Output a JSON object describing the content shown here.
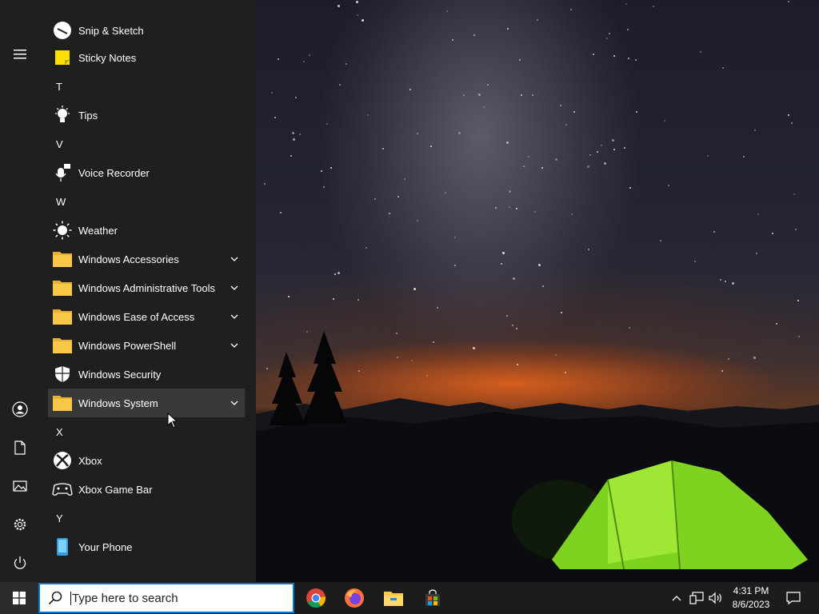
{
  "start_menu": {
    "partial_item": "Snip & Sketch",
    "items": [
      {
        "kind": "app",
        "label": "Sticky Notes",
        "icon": "sticky-notes-icon"
      },
      {
        "kind": "letter",
        "label": "T"
      },
      {
        "kind": "app",
        "label": "Tips",
        "icon": "lightbulb-icon"
      },
      {
        "kind": "letter",
        "label": "V"
      },
      {
        "kind": "app",
        "label": "Voice Recorder",
        "icon": "microphone-icon"
      },
      {
        "kind": "letter",
        "label": "W"
      },
      {
        "kind": "app",
        "label": "Weather",
        "icon": "sun-icon"
      },
      {
        "kind": "folder",
        "label": "Windows Accessories",
        "icon": "folder-icon"
      },
      {
        "kind": "folder",
        "label": "Windows Administrative Tools",
        "icon": "folder-icon"
      },
      {
        "kind": "folder",
        "label": "Windows Ease of Access",
        "icon": "folder-icon"
      },
      {
        "kind": "folder",
        "label": "Windows PowerShell",
        "icon": "folder-icon"
      },
      {
        "kind": "app",
        "label": "Windows Security",
        "icon": "shield-icon"
      },
      {
        "kind": "folder",
        "label": "Windows System",
        "icon": "folder-icon",
        "highlighted": true
      },
      {
        "kind": "letter",
        "label": "X"
      },
      {
        "kind": "app",
        "label": "Xbox",
        "icon": "xbox-icon"
      },
      {
        "kind": "app",
        "label": "Xbox Game Bar",
        "icon": "xbox-game-bar-icon"
      },
      {
        "kind": "letter",
        "label": "Y"
      },
      {
        "kind": "app",
        "label": "Your Phone",
        "icon": "phone-icon"
      }
    ],
    "rail": [
      "menu-icon",
      "user-icon",
      "documents-icon",
      "pictures-icon",
      "settings-icon",
      "power-icon"
    ]
  },
  "taskbar": {
    "search_placeholder": "Type here to search",
    "pinned": [
      "chrome-icon",
      "firefox-icon",
      "file-explorer-icon",
      "microsoft-store-icon"
    ],
    "clock": {
      "time": "4:31 PM",
      "date": "8/6/2023"
    }
  },
  "colors": {
    "accent": "#0078d7",
    "menu_bg": "#1f1f1f",
    "taskbar_bg": "#1c1c1c",
    "folder": "#f8c846"
  }
}
